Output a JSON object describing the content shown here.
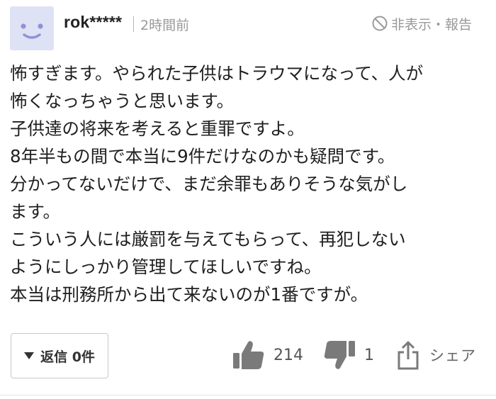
{
  "comment": {
    "username": "rok*****",
    "time": "2時間前",
    "hide_report": "非表示・報告",
    "lines": [
      "怖すぎます。やられた子供はトラウマになって、人が",
      "怖くなっちゃうと思います。",
      "子供達の将来を考えると重罪ですよ。",
      "8年半もの間で本当に9件だけなのかも疑問です。",
      "分かってないだけで、まだ余罪もありそうな気がし",
      "ます。",
      "こういう人には厳罰を与えてもらって、再犯しない",
      "ようにしっかり管理してほしいですね。",
      "本当は刑務所から出て来ないのが1番ですが。"
    ]
  },
  "actions": {
    "reply_label": "返信 0件",
    "like_count": "214",
    "dislike_count": "1",
    "share_label": "シェア"
  },
  "icons": {
    "avatar": "smiley-face-icon",
    "hide": "ban-icon",
    "reply": "caret-down-icon",
    "like": "thumbs-up-icon",
    "dislike": "thumbs-down-icon",
    "share": "share-icon"
  },
  "colors": {
    "avatar_bg": "#dfe1f4",
    "avatar_face": "#8d93d6",
    "icon_gray": "#7a7a7a",
    "muted_text": "#999999"
  }
}
